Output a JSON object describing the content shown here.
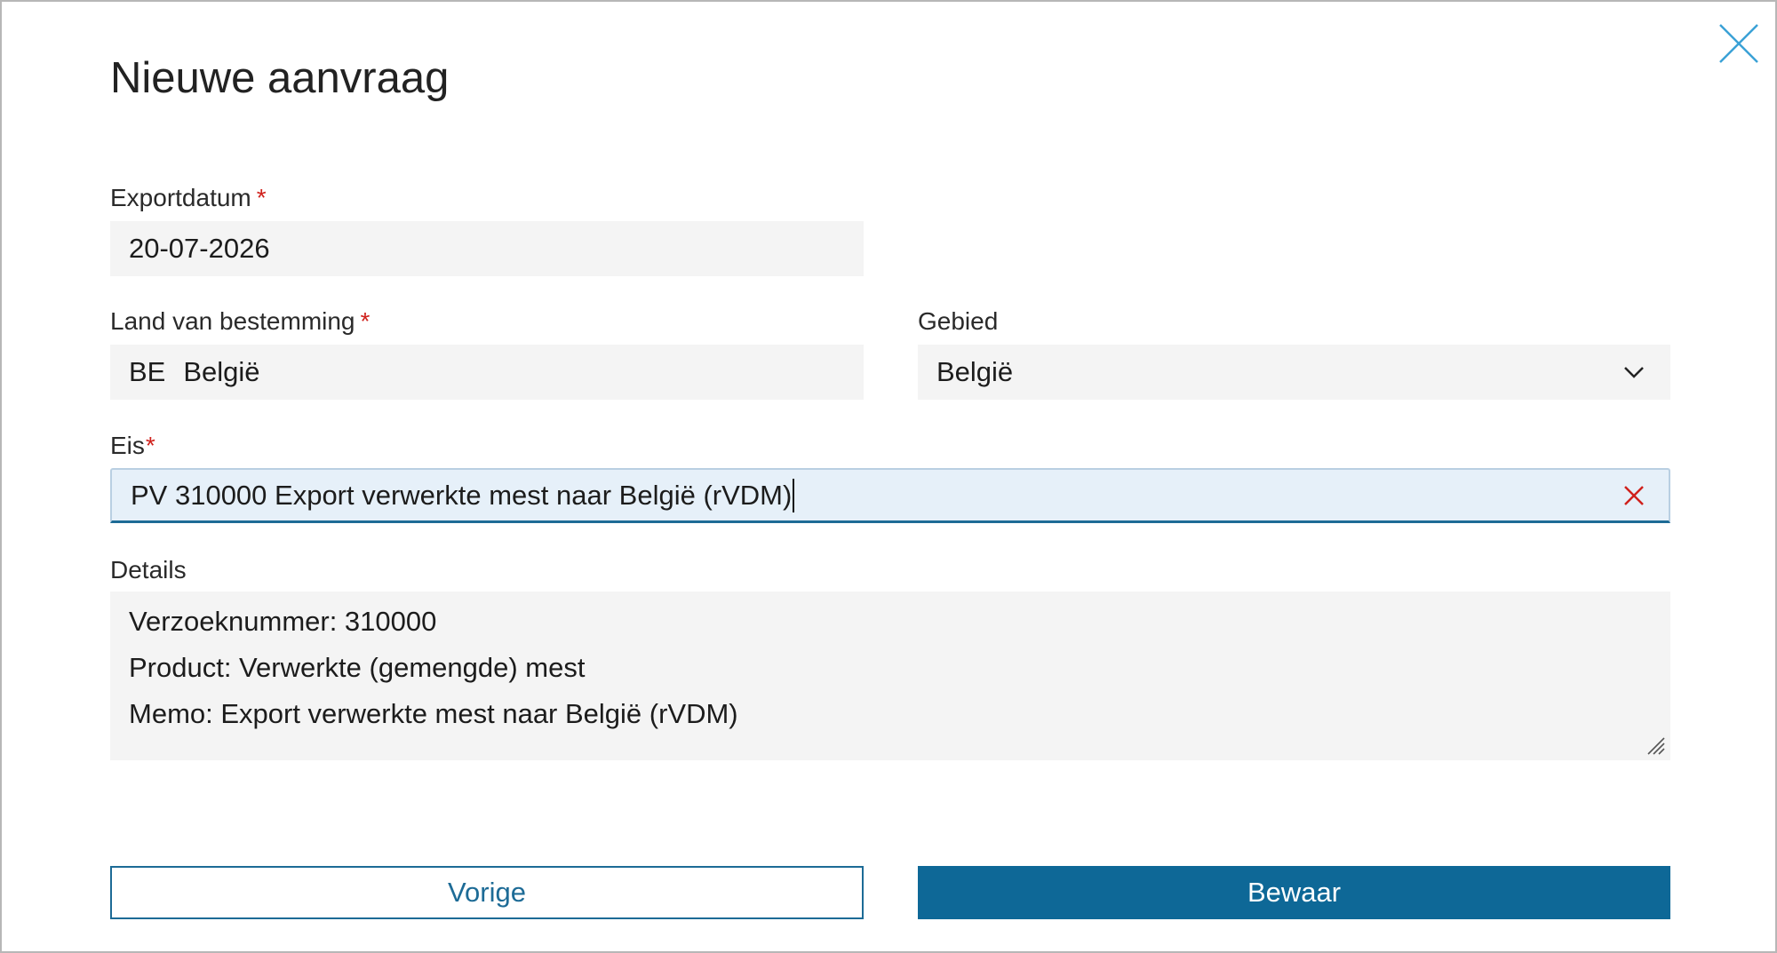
{
  "dialog": {
    "title": "Nieuwe aanvraag"
  },
  "fields": {
    "exportdatum": {
      "label": "Exportdatum",
      "required_mark": "*",
      "value": "20-07-2026"
    },
    "land": {
      "label": "Land van bestemming",
      "required_mark": "*",
      "code": "BE",
      "value": "België"
    },
    "gebied": {
      "label": "Gebied",
      "selected": "België"
    },
    "eis": {
      "label": "Eis",
      "required_mark": "*",
      "value": "PV 310000 Export verwerkte mest naar België (rVDM)"
    },
    "details": {
      "label": "Details",
      "lines": [
        "Verzoeknummer: 310000",
        "Product: Verwerkte (gemengde) mest",
        "Memo: Export verwerkte mest naar België (rVDM)"
      ]
    }
  },
  "buttons": {
    "previous": "Vorige",
    "save": "Bewaar"
  },
  "icons": {
    "close": "close-icon",
    "chevron": "chevron-down-icon",
    "clear": "clear-icon",
    "resize": "resize-handle-icon"
  },
  "colors": {
    "primary": "#0e6897",
    "required": "#d0211c",
    "close_icon": "#3aa1d6",
    "field_bg": "#f4f4f4",
    "active_field_bg": "#e6f0f9"
  }
}
